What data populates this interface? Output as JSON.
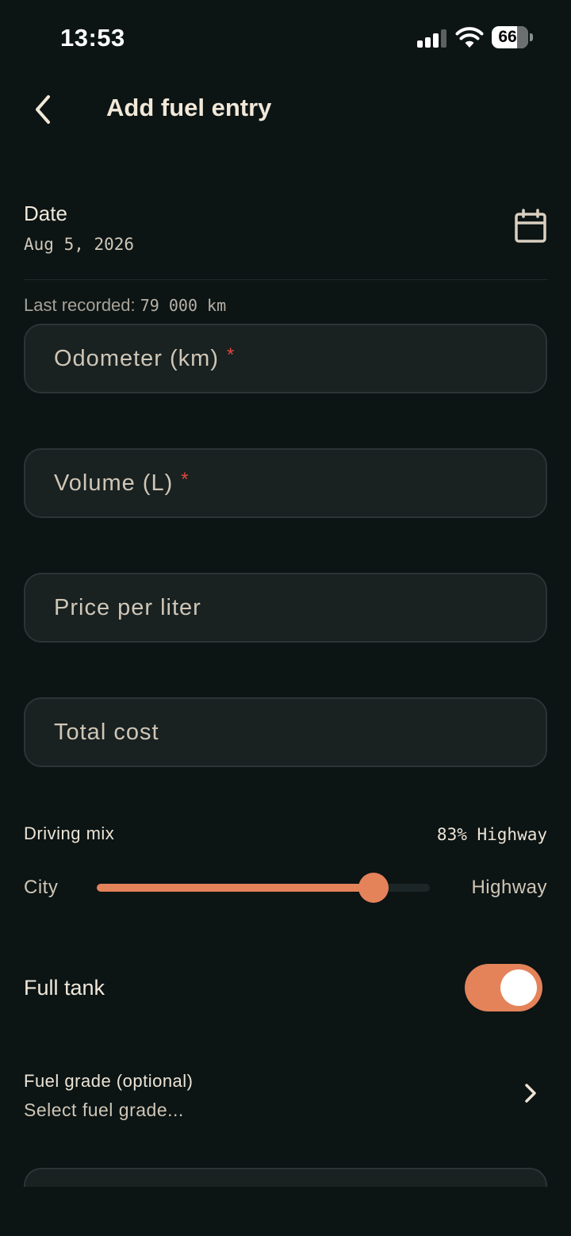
{
  "status_bar": {
    "time": "13:53",
    "battery": "66",
    "signal_icon": "cellular-signal-icon",
    "wifi_icon": "wifi-icon"
  },
  "header": {
    "title": "Add fuel entry",
    "back_icon": "chevron-left-icon"
  },
  "date": {
    "label": "Date",
    "value": "Aug 5, 2026",
    "icon": "calendar-icon"
  },
  "odometer_hint": {
    "prefix": "Last recorded:",
    "value": "79 000 km"
  },
  "fields": {
    "odometer": {
      "placeholder": "Odometer (km)",
      "required_mark": "*"
    },
    "volume": {
      "placeholder": "Volume (L)",
      "required_mark": "*"
    },
    "price": {
      "placeholder": "Price per liter"
    },
    "total": {
      "placeholder": "Total cost"
    }
  },
  "driving_mix": {
    "label": "Driving mix",
    "value_text": "83% Highway",
    "min_label": "City",
    "max_label": "Highway",
    "highway_fraction": 0.83
  },
  "full_tank": {
    "label": "Full tank",
    "enabled": true
  },
  "fuel_grade": {
    "label": "Fuel grade (optional)",
    "value": "Select fuel grade...",
    "icon": "chevron-right-icon"
  },
  "colors": {
    "background": "#0c1414",
    "field_background": "#192121",
    "accent": "#e4825a",
    "required": "#e0473b",
    "text": "#ece4d6"
  }
}
